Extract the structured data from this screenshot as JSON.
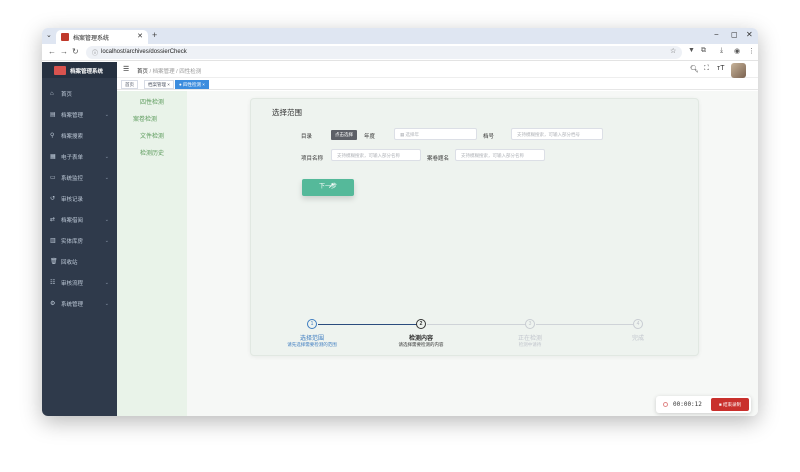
{
  "browser": {
    "tab_title": "档案管理系统",
    "url": "localhost/archives/dossierCheck",
    "new_tab": "+",
    "minimize": "−",
    "maximize": "◻",
    "close": "✕"
  },
  "sidebar": {
    "app_title": "档案管理系统",
    "items": [
      {
        "label": "首页",
        "icon": "home-icon",
        "arrow": false
      },
      {
        "label": "档案管理",
        "icon": "folder-icon",
        "arrow": true
      },
      {
        "label": "档案搜索",
        "icon": "search-icon",
        "arrow": false
      },
      {
        "label": "电子表单",
        "icon": "form-icon",
        "arrow": true
      },
      {
        "label": "系统监控",
        "icon": "monitor-icon",
        "arrow": true
      },
      {
        "label": "审核记录",
        "icon": "record-icon",
        "arrow": false
      },
      {
        "label": "档案借阅",
        "icon": "borrow-icon",
        "arrow": true
      },
      {
        "label": "实体库房",
        "icon": "warehouse-icon",
        "arrow": true
      },
      {
        "label": "回收站",
        "icon": "trash-icon",
        "arrow": false
      },
      {
        "label": "审核流程",
        "icon": "flow-icon",
        "arrow": true
      },
      {
        "label": "系统管理",
        "icon": "gear-icon",
        "arrow": true
      }
    ]
  },
  "header": {
    "breadcrumb": [
      "首页",
      "档案管理",
      "四性检测"
    ],
    "separator": "/"
  },
  "tags": [
    {
      "label": "首页",
      "active": false
    },
    {
      "label": "档案管理",
      "active": false
    },
    {
      "label": "四性检测",
      "active": true
    }
  ],
  "subnav": [
    "四性检测",
    "案卷检测",
    "文件检测",
    "检测历史"
  ],
  "form": {
    "title": "选择范围",
    "catalog_label": "目录",
    "catalog_button": "点击选择",
    "year_label": "年度",
    "year_placeholder": "选择年",
    "file_no_label": "档号",
    "file_no_placeholder": "支持模糊搜索，可输入部分档号",
    "project_label": "项目名称",
    "project_placeholder": "支持模糊搜索，可输入部分名称",
    "dossier_label": "案卷题名",
    "dossier_placeholder": "支持模糊搜索，可输入部分名称",
    "next_button": "下一步"
  },
  "steps": [
    {
      "num": "1",
      "title": "选择范围",
      "desc": "请先选择需要检测的范围",
      "status": "finish"
    },
    {
      "num": "2",
      "title": "检测内容",
      "desc": "请选择需要检测的内容",
      "status": "process"
    },
    {
      "num": "3",
      "title": "正在检测",
      "desc": "检测中请待",
      "status": "wait"
    },
    {
      "num": "4",
      "title": "完成",
      "desc": "",
      "status": "wait"
    }
  ],
  "timer": {
    "time": "00:00:12",
    "stop_button": "结束录制"
  }
}
